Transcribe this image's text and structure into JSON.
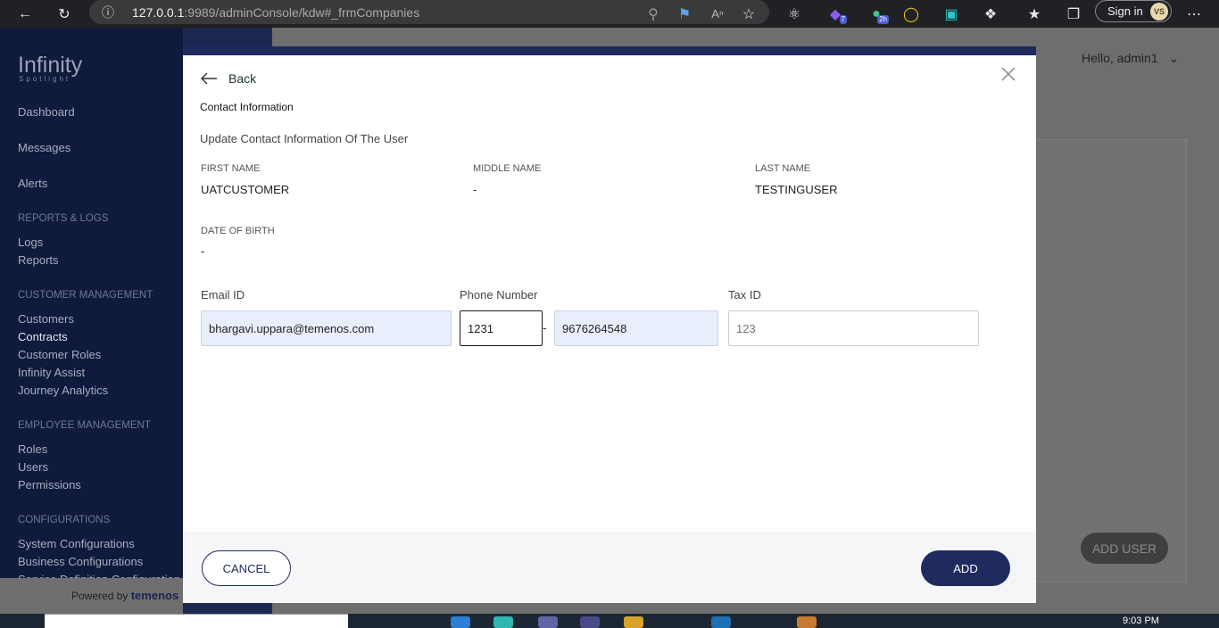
{
  "browser": {
    "url_host": "127.0.0.1",
    "url_path": ":9989/adminConsole/kdw#_frmCompanies",
    "sign_in_label": "Sign in",
    "avatar_initials": "VS",
    "ext_badge_1": "7",
    "ext_badge_2": "2h"
  },
  "sidebar": {
    "logo": "Infinity",
    "logo_sub": "Spotlight",
    "items": [
      {
        "label": "Dashboard"
      },
      {
        "label": "Messages"
      },
      {
        "label": "Alerts"
      }
    ],
    "sections": [
      {
        "header": "REPORTS & LOGS",
        "items": [
          "Logs",
          "Reports"
        ]
      },
      {
        "header": "CUSTOMER MANAGEMENT",
        "items": [
          "Customers",
          "Contracts",
          "Customer Roles",
          "Infinity Assist",
          "Journey Analytics"
        ]
      },
      {
        "header": "EMPLOYEE MANAGEMENT",
        "items": [
          "Roles",
          "Users",
          "Permissions"
        ]
      },
      {
        "header": "CONFIGURATIONS",
        "items": [
          "System Configurations",
          "Business Configurations",
          "Service Definition Configuration"
        ]
      }
    ],
    "powered_by": "Powered by",
    "powered_brand": "temenos"
  },
  "header": {
    "hello": "Hello, admin1"
  },
  "main": {
    "add_user_label": "ADD USER"
  },
  "modal": {
    "back_label": "Back",
    "title": "Contact Information",
    "subtitle": "Update Contact Information Of The User",
    "fields": {
      "first_name_label": "FIRST NAME",
      "first_name": "UATCUSTOMER",
      "middle_name_label": "MIDDLE NAME",
      "middle_name": "-",
      "last_name_label": "LAST NAME",
      "last_name": "TESTINGUSER",
      "dob_label": "DATE OF BIRTH",
      "dob": "-"
    },
    "inputs": {
      "email_label": "Email ID",
      "email_value": "bhargavi.uppara@temenos.com",
      "phone_label": "Phone Number",
      "phone_code_value": "1231",
      "phone_separator": "-",
      "phone_number_value": "9676264548",
      "tax_label": "Tax ID",
      "tax_placeholder": "123"
    },
    "cancel_label": "CANCEL",
    "add_label": "ADD"
  },
  "taskbar": {
    "time": "9:03 PM"
  },
  "colors": {
    "primary": "#1f2a5e",
    "input_filled": "#e8eefc",
    "sidebar": "#0f1a3d"
  }
}
